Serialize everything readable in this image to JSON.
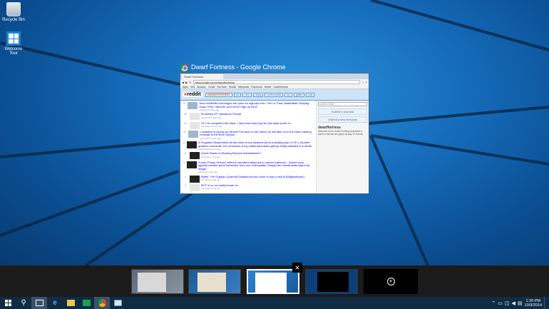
{
  "desktop": {
    "icons": [
      {
        "label": "Recycle Bin"
      },
      {
        "label": "Welcome Tour"
      }
    ]
  },
  "window": {
    "title": "Dwarf Fortness - Google Chrome",
    "tab_title": "Dwarf Fortness",
    "url": "www.reddit.com/r/dwarffortress/",
    "bookmarks": [
      "Apps",
      "IGN",
      "Amazon",
      "Gmail",
      "YouTube",
      "Reddit",
      "Wikipedia",
      "Facebook",
      "Netflix",
      "Dwarffortress"
    ],
    "reddit": {
      "logo": "reddit",
      "subreddit_tabs": [
        "DWARFFORTRESS",
        "hot",
        "new",
        "rising",
        "controversial",
        "top",
        "gilded",
        "wiki"
      ],
      "posts": [
        {
          "votes": "57",
          "title": "New redditoffs exchanges are open for signups now: Trim or Treat, Basketball, Bullying Dogs, Pets, Haircuts, and more! Sign up here!",
          "meta": "submitted 2 days ago"
        },
        {
          "votes": "26",
          "title": "Bi-weekly DF Questions Thread",
          "meta": "submitted 5 days ago"
        },
        {
          "votes": "14",
          "title": "So I've completed the ritual. I had bored and toys for two days worth of...",
          "meta": "submitted 6 hours ago"
        },
        {
          "votes": "31",
          "title": "Lucabanzi is giving you Bofurn Furnace to use others he will take on in the clean starting revenge of the Bron Spears",
          "meta": "submitted 9 hours ago"
        },
        {
          "votes": "8",
          "title": "A Forgotten Beast killed all bar three of my dwarves (from a starting pop of 75+). By their grateful comments, the remnants of my militia barricades gemsy bodily stabbed it to death",
          "meta": "submitted 12 hours ago"
        },
        {
          "votes": "5",
          "title": "Dumb Rando is Slowing Mosuke Administrator?",
          "meta": "submitted 1 day ago"
        },
        {
          "votes": "9",
          "title": "Funny 'Plump Helmet' with the members attached to various interests... Would such against sudden spiral behaviour from one cell/crystals, though the overall stats might not image.",
          "meta": "submitted 1 day ago"
        },
        {
          "votes": "4",
          "title": "Boffin, The Organic Quarrelly Deadwood has come to pay a visit to [Migbeakeper]",
          "meta": "submitted 1 day ago"
        },
        {
          "votes": "3",
          "title": "BCF is no no hardly boom on",
          "meta": "submitted 1 day ago"
        }
      ],
      "sidebar": {
        "search_placeholder": "search reddit",
        "submit_link": "Submit a new link",
        "submit_text": "Submit a new text post",
        "sub_title": "dwarffortress",
        "description": "Welcome to the Dwarf Fortness subreddit, a place to discuss the game by Bay 12 Games."
      }
    }
  },
  "taskbar": {
    "time": "1:20 PM",
    "date": "10/3/2014"
  }
}
